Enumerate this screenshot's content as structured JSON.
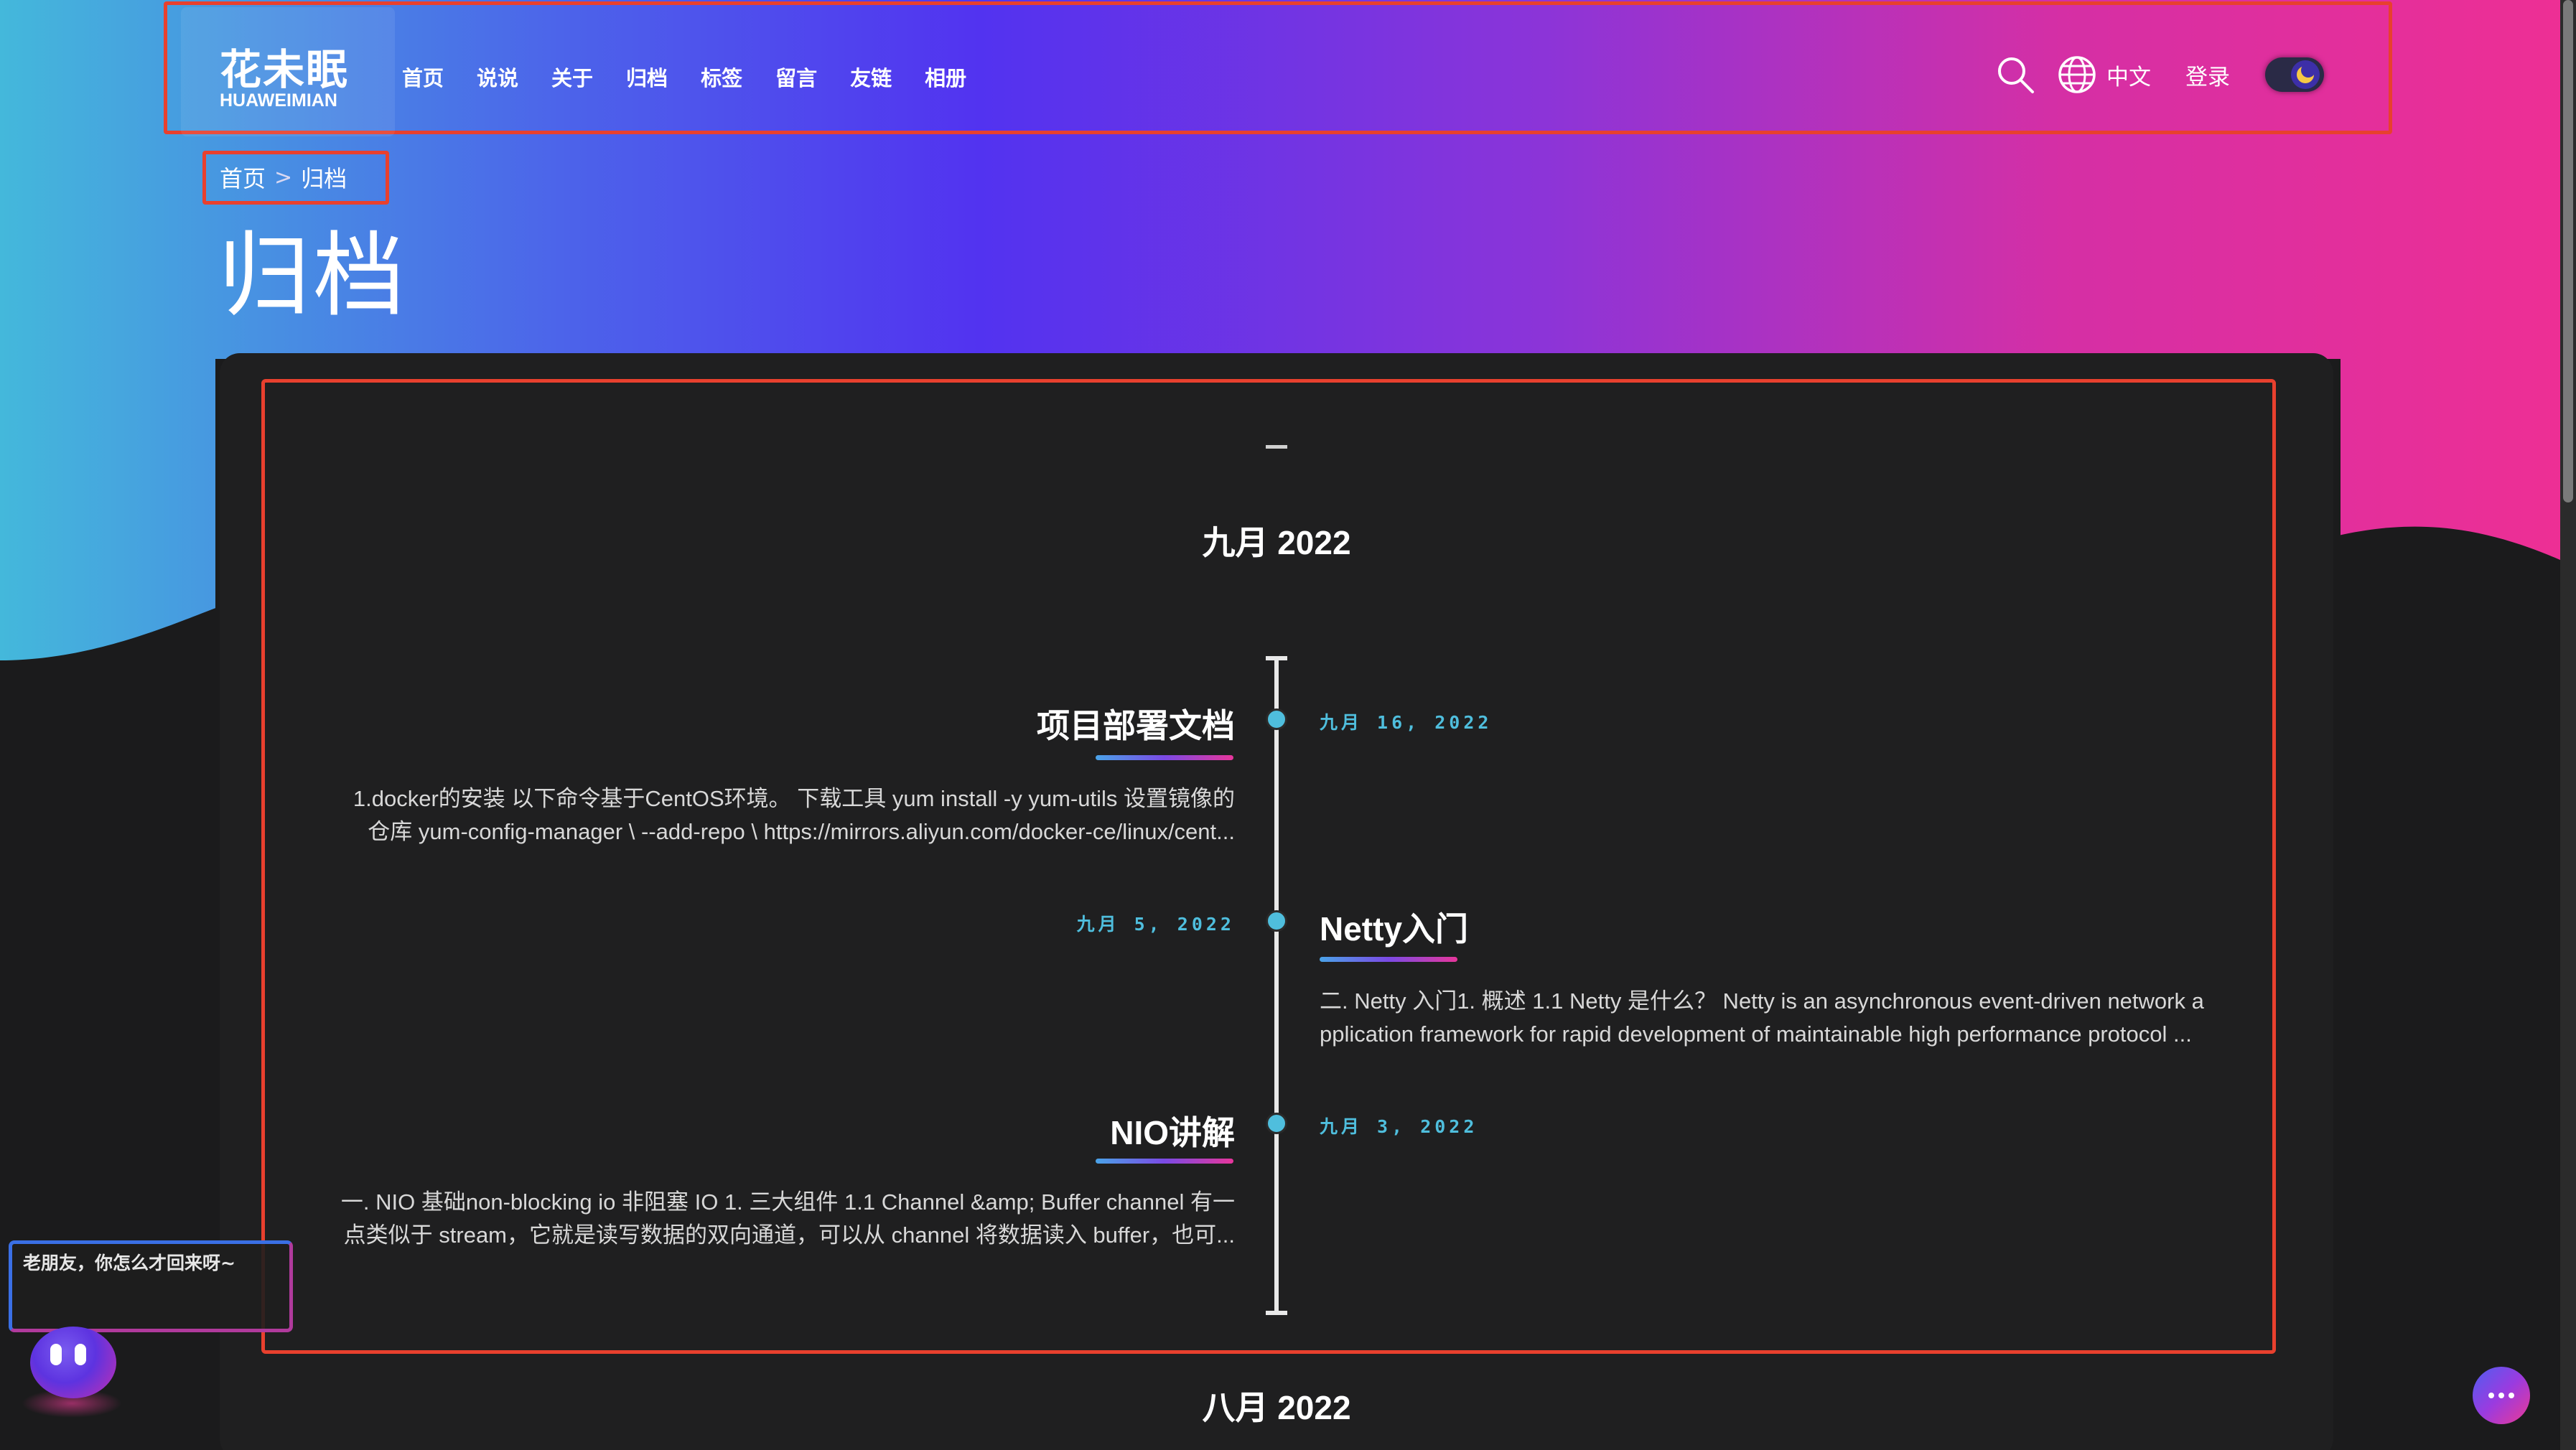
{
  "site": {
    "logo_title": "花未眠",
    "logo_sub": "HUAWEIMIAN"
  },
  "nav": {
    "items": [
      "首页",
      "说说",
      "关于",
      "归档",
      "标签",
      "留言",
      "友链",
      "相册"
    ]
  },
  "header": {
    "search_icon": "search-icon",
    "lang_icon": "globe-icon",
    "lang_label": "中文",
    "login_label": "登录",
    "theme_toggle": "dark"
  },
  "breadcrumb": {
    "home": "首页",
    "separator": ">",
    "current": "归档"
  },
  "page": {
    "title": "归档"
  },
  "archive": {
    "dash": "–",
    "month_1": "九月 2022",
    "month_2": "八月 2022",
    "posts": [
      {
        "title": "项目部署文档",
        "date": "九月 16, 2022",
        "excerpt_line1": "1.docker的安装 以下命令基于CentOS环境。 下载工具 yum install -y yum-utils 设置镜像的",
        "excerpt_line2": "仓库 yum-config-manager \\ --add-repo \\ https://mirrors.aliyun.com/docker-ce/linux/cent..."
      },
      {
        "title": "Netty入门",
        "date": "九月 5, 2022",
        "excerpt_line1": "二. Netty 入门1. 概述 1.1 Netty 是什么？ Netty is an asynchronous event-driven network a",
        "excerpt_line2": "pplication framework for rapid development of maintainable high performance protocol ..."
      },
      {
        "title": "NIO讲解",
        "date": "九月 3, 2022",
        "excerpt_line1": "一. NIO 基础non-blocking io 非阻塞 IO 1. 三大组件 1.1 Channel &amp; Buffer channel 有一",
        "excerpt_line2": "点类似于 stream，它就是读写数据的双向通道，可以从 channel 将数据读入 buffer，也可..."
      }
    ]
  },
  "mascot": {
    "message": "老朋友，你怎么才回来呀~"
  },
  "colors": {
    "accent_dot": "#4fbedd",
    "frame": "#e8402e",
    "card_bg": "#1f1f20"
  }
}
